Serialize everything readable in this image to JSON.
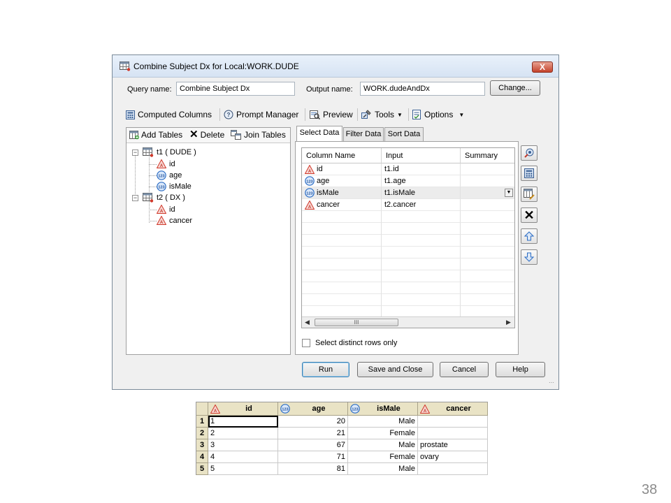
{
  "window": {
    "title": "Combine Subject Dx for Local:WORK.DUDE",
    "close_glyph": "X"
  },
  "query": {
    "query_name_label": "Query name:",
    "query_name_value": "Combine Subject Dx",
    "output_name_label": "Output name:",
    "output_name_value": "WORK.dudeAndDx",
    "change_button": "Change..."
  },
  "toolbar": {
    "computed_columns": "Computed Columns",
    "prompt_manager": "Prompt Manager",
    "preview": "Preview",
    "tools": "Tools",
    "options": "Options"
  },
  "tree_toolbar": {
    "add_tables": "Add Tables",
    "delete": "Delete",
    "join_tables": "Join Tables"
  },
  "tree": {
    "tables": [
      {
        "label": "t1 ( DUDE )",
        "columns": [
          {
            "name": "id",
            "type": "char"
          },
          {
            "name": "age",
            "type": "num"
          },
          {
            "name": "isMale",
            "type": "num"
          }
        ]
      },
      {
        "label": "t2 ( DX )",
        "columns": [
          {
            "name": "id",
            "type": "char"
          },
          {
            "name": "cancer",
            "type": "char"
          }
        ]
      }
    ]
  },
  "tabs": [
    "Select Data",
    "Filter Data",
    "Sort Data"
  ],
  "select_grid": {
    "headers": [
      "Column Name",
      "Input",
      "Summary"
    ],
    "rows": [
      {
        "name": "id",
        "type": "char",
        "input": "t1.id",
        "summary": ""
      },
      {
        "name": "age",
        "type": "num",
        "input": "t1.age",
        "summary": ""
      },
      {
        "name": "isMale",
        "type": "num",
        "input": "t1.isMale",
        "summary": ""
      },
      {
        "name": "cancer",
        "type": "char",
        "input": "t2.cancer",
        "summary": ""
      }
    ],
    "scroll_thumb_label": "III"
  },
  "distinct_label": "Select distinct rows only",
  "buttons": {
    "run": "Run",
    "save_close": "Save and Close",
    "cancel": "Cancel",
    "help": "Help"
  },
  "result_table": {
    "headers": [
      {
        "name": "id",
        "type": "char"
      },
      {
        "name": "age",
        "type": "num"
      },
      {
        "name": "isMale",
        "type": "num"
      },
      {
        "name": "cancer",
        "type": "char"
      }
    ],
    "rows": [
      {
        "n": "1",
        "id": "1",
        "age": "20",
        "isMale": "Male",
        "cancer": ""
      },
      {
        "n": "2",
        "id": "2",
        "age": "21",
        "isMale": "Female",
        "cancer": ""
      },
      {
        "n": "3",
        "id": "3",
        "age": "67",
        "isMale": "Male",
        "cancer": "prostate"
      },
      {
        "n": "4",
        "id": "4",
        "age": "71",
        "isMale": "Female",
        "cancer": "ovary"
      },
      {
        "n": "5",
        "id": "5",
        "age": "81",
        "isMale": "Male",
        "cancer": ""
      }
    ]
  },
  "page_number": "38",
  "colors": {
    "char_icon": "#e04b3a",
    "num_icon": "#2b6cc4",
    "table_header_bg": "#e9e3c5"
  }
}
